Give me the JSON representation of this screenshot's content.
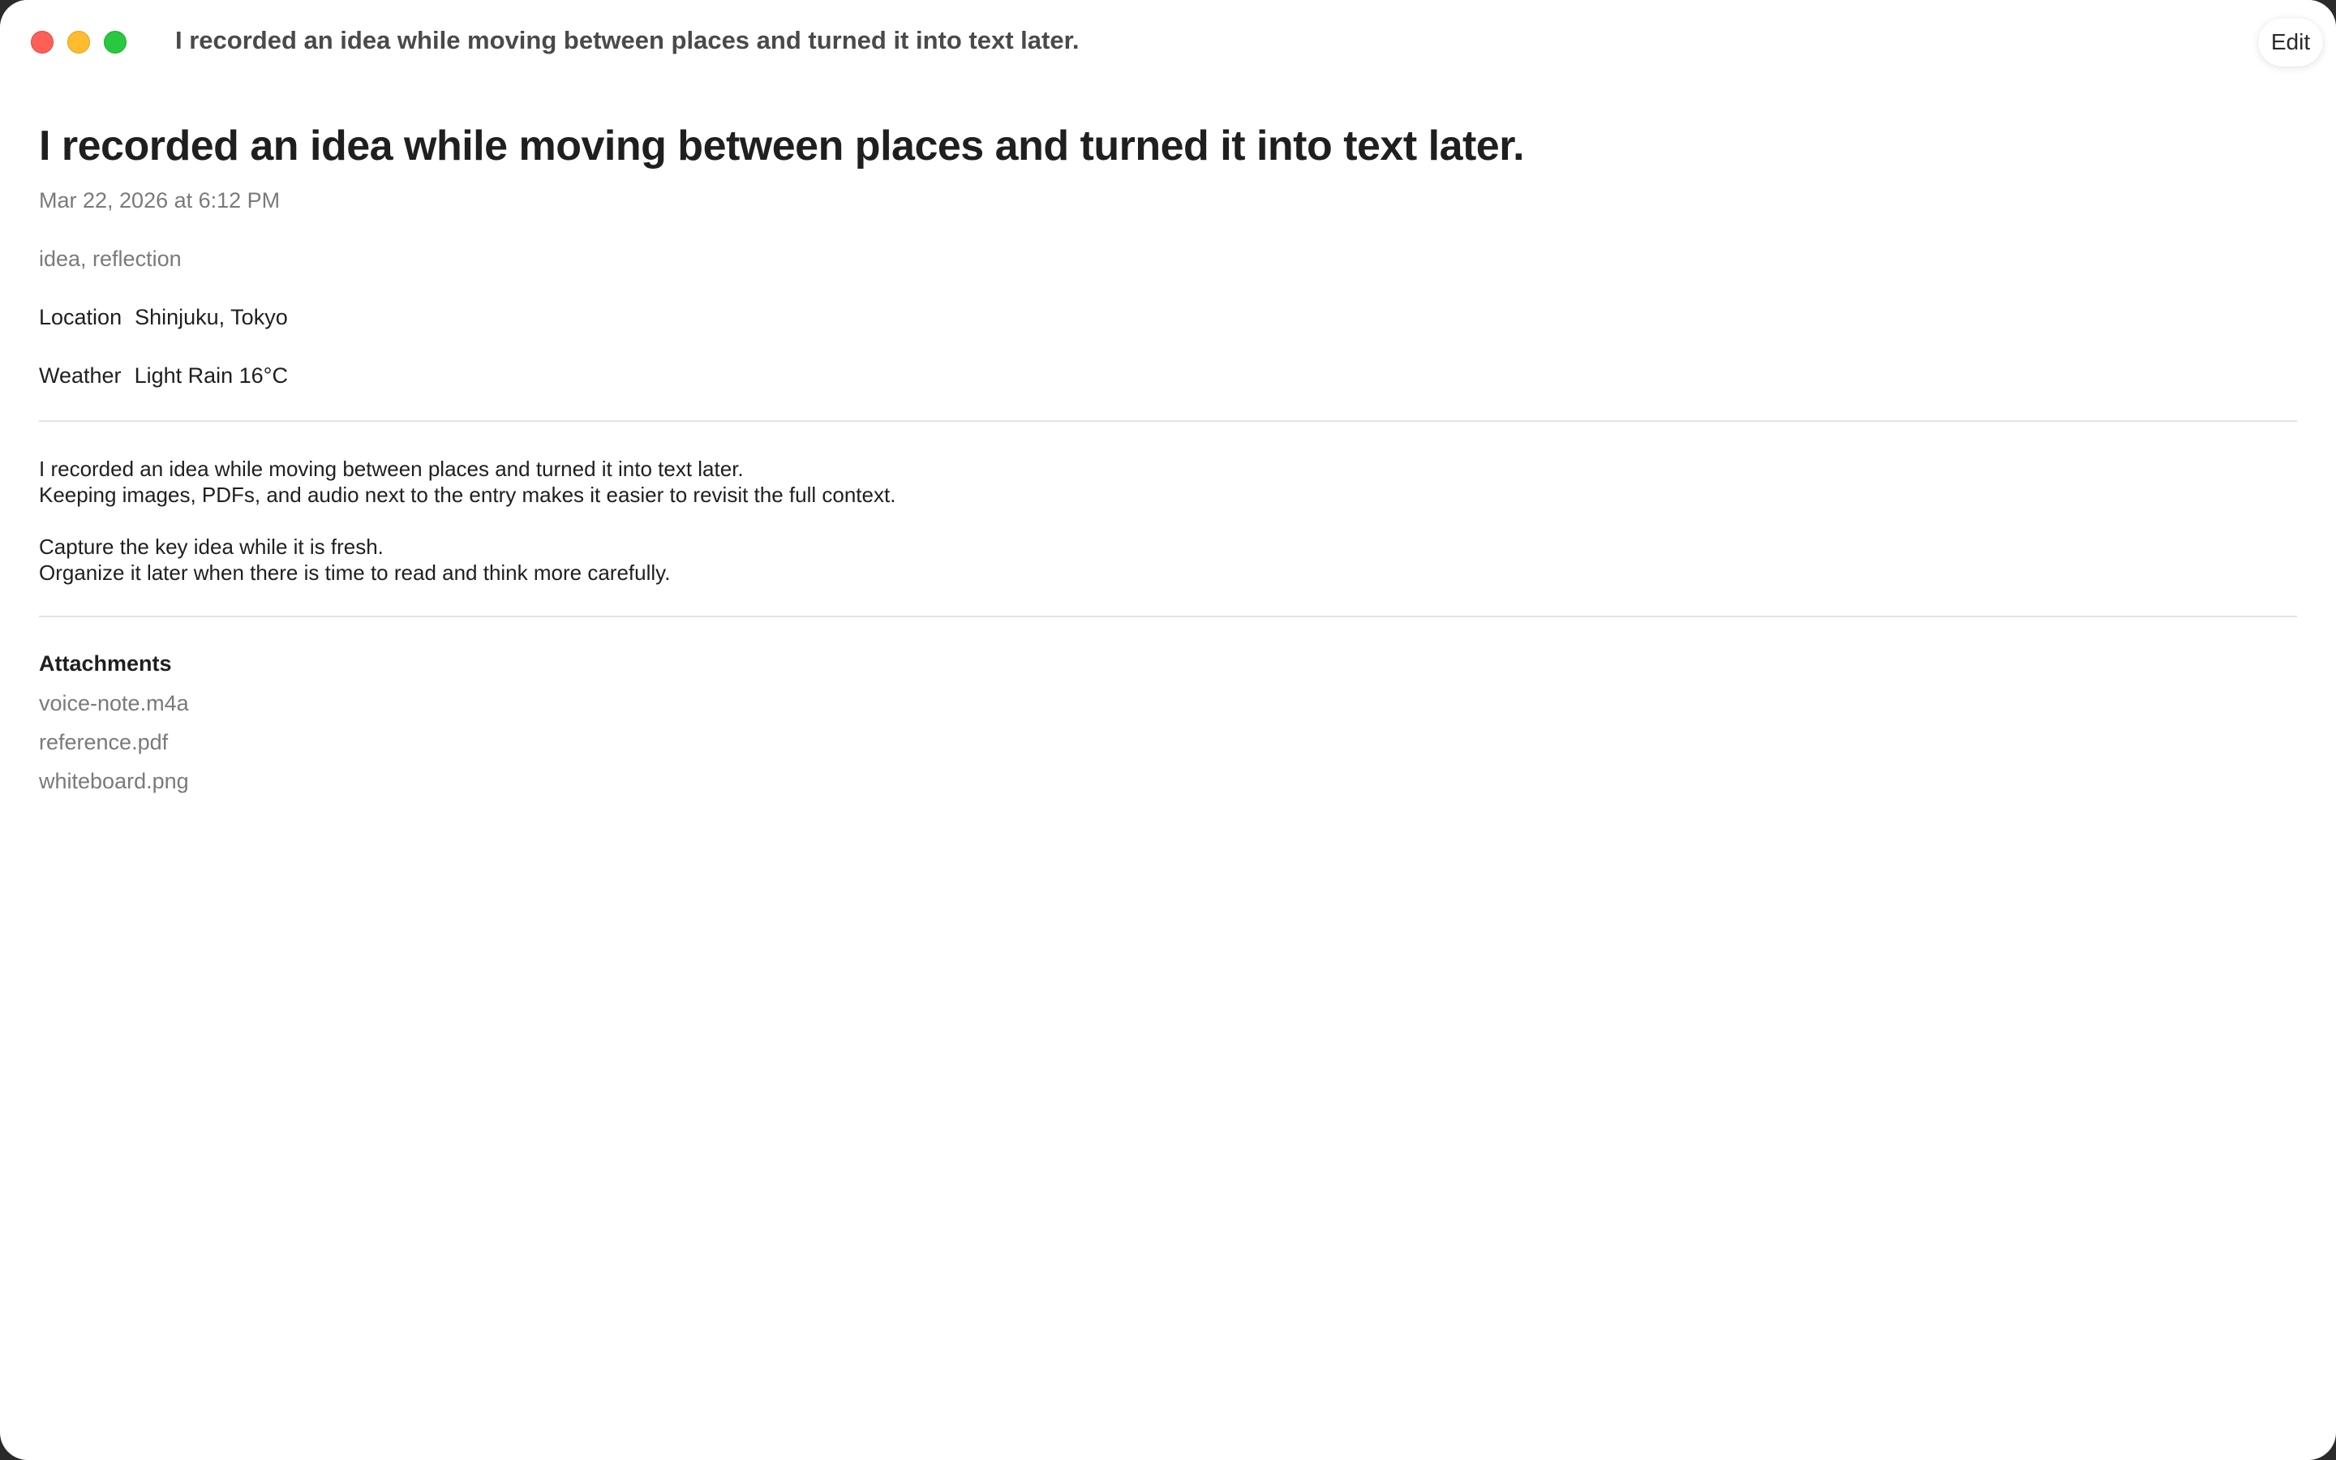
{
  "window": {
    "title": "I recorded an idea while moving between places and turned it into text later.",
    "edit_label": "Edit"
  },
  "entry": {
    "title": "I recorded an idea while moving between places and turned it into text later.",
    "date": "Mar 22, 2026 at 6:12 PM",
    "tags": "idea, reflection",
    "location_label": "Location",
    "location_value": "Shinjuku, Tokyo",
    "weather_label": "Weather",
    "weather_value": "Light Rain 16°C",
    "body": [
      "I recorded an idea while moving between places and turned it into text later.",
      "Keeping images, PDFs, and audio next to the entry makes it easier to revisit the full context.",
      "",
      "Capture the key idea while it is fresh.",
      "Organize it later when there is time to read and think more carefully."
    ]
  },
  "attachments": {
    "heading": "Attachments",
    "items": [
      "voice-note.m4a",
      "reference.pdf",
      "whiteboard.png"
    ]
  },
  "colors": {
    "close": "#ff5f57",
    "minimize": "#febc2e",
    "zoom": "#28c840",
    "text_primary": "#1f1f1f",
    "text_secondary": "#7a7a7a"
  }
}
